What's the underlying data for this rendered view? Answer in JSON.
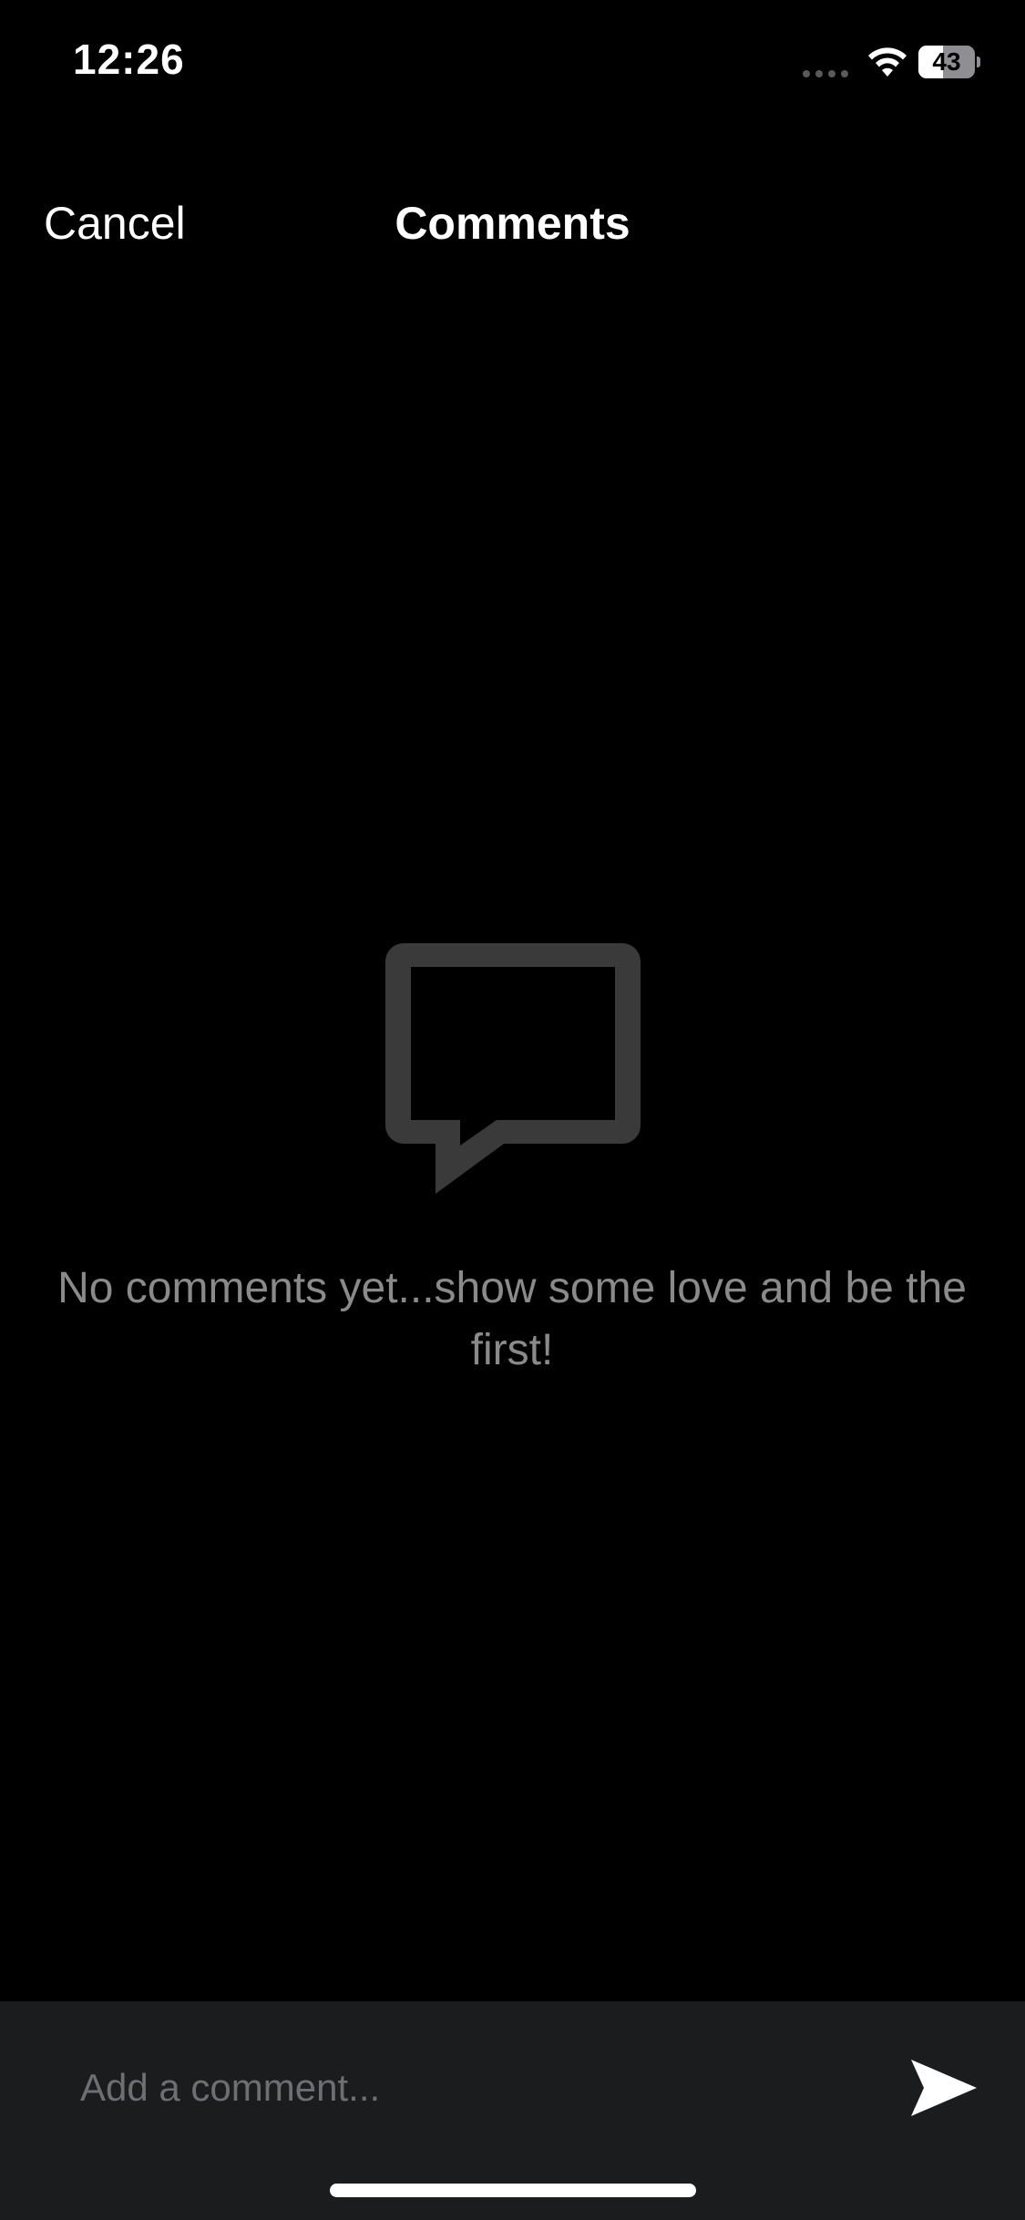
{
  "status_bar": {
    "time": "12:26",
    "battery_level": "43",
    "battery_fraction": 0.43,
    "icons": [
      "signal-dots-icon",
      "wifi-icon",
      "battery-icon"
    ]
  },
  "nav": {
    "cancel_label": "Cancel",
    "title": "Comments"
  },
  "empty_state": {
    "icon": "comment-bubble-icon",
    "message": "No comments yet...show some love and be the first!"
  },
  "comment_bar": {
    "placeholder": "Add a comment...",
    "send_icon": "send-icon"
  },
  "colors": {
    "background": "#000000",
    "icon_gray": "#3a3a3a",
    "message_gray": "#8a8a8a",
    "input_bar": "#1b1c1e",
    "placeholder": "#6e6f72"
  }
}
